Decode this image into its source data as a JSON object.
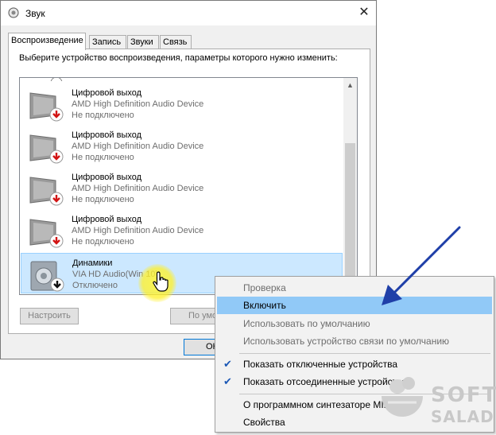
{
  "window": {
    "title": "Звук",
    "tabs": [
      "Воспроизведение",
      "Запись",
      "Звуки",
      "Связь"
    ],
    "instruction": "Выберите устройство воспроизведения, параметры которого нужно изменить:"
  },
  "devices": [
    {
      "name": "Цифровой выход",
      "driver": "AMD High Definition Audio Device",
      "status": "Не подключено",
      "icon": "monitor-icon",
      "badge": "red-down-arrow-icon"
    },
    {
      "name": "Цифровой выход",
      "driver": "AMD High Definition Audio Device",
      "status": "Не подключено",
      "icon": "monitor-icon",
      "badge": "red-down-arrow-icon"
    },
    {
      "name": "Цифровой выход",
      "driver": "AMD High Definition Audio Device",
      "status": "Не подключено",
      "icon": "monitor-icon",
      "badge": "red-down-arrow-icon"
    },
    {
      "name": "Цифровой выход",
      "driver": "AMD High Definition Audio Device",
      "status": "Не подключено",
      "icon": "monitor-icon",
      "badge": "red-down-arrow-icon"
    },
    {
      "name": "Динамики",
      "driver": "VIA HD Audio(Win 10)",
      "status": "Отключено",
      "icon": "speaker-icon",
      "badge": "black-down-arrow-icon",
      "selected": true
    }
  ],
  "buttons": {
    "configure": "Настроить",
    "default": "По умо",
    "ok": "ОК"
  },
  "context_menu": {
    "items": [
      {
        "label": "Проверка",
        "disabled": true
      },
      {
        "label": "Включить",
        "highlighted": true
      },
      {
        "label": "Использовать по умолчанию",
        "disabled": true
      },
      {
        "label": "Использовать устройство связи по умолчанию",
        "disabled": true
      },
      {
        "label": "Показать отключенные устройства",
        "checked": true
      },
      {
        "label": "Показать отсоединенные устройства",
        "checked": true
      },
      {
        "label": "О программном синтезаторе MIDI"
      },
      {
        "label": "Свойства"
      }
    ]
  },
  "watermark": {
    "line1": "SOFT",
    "line2": "SALAD"
  },
  "colors": {
    "accent_arrow": "#1f3fa8",
    "selection": "#cce8ff",
    "menu_highlight": "#91c9f7",
    "cursor_glow": "#fff43c"
  }
}
